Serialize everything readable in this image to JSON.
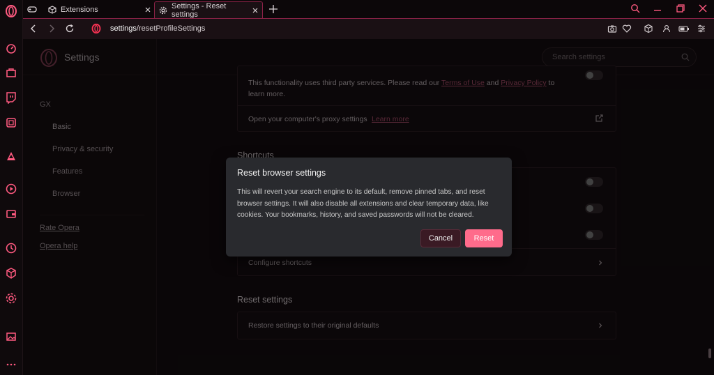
{
  "tabs": [
    {
      "label": "Extensions"
    },
    {
      "label": "Settings - Reset settings"
    }
  ],
  "address": {
    "host": "settings",
    "path": "/resetProfileSettings"
  },
  "settings": {
    "header_title": "Settings",
    "search_placeholder": "Search settings",
    "nav": {
      "section": "GX",
      "items": [
        "Basic",
        "Privacy & security",
        "Features",
        "Browser"
      ],
      "links": [
        "Rate Opera",
        "Opera help"
      ]
    },
    "proxy_card": {
      "notice_pre": "This functionality uses third party services. Please read our",
      "terms": "Terms of Use",
      "and": "and",
      "privacy": "Privacy Policy",
      "notice_post": "to",
      "notice_line2": "learn more.",
      "proxy_label": "Open your computer's proxy settings",
      "learn_more": "Learn more"
    },
    "shortcuts": {
      "title": "Shortcuts",
      "configure": "Configure shortcuts"
    },
    "reset": {
      "title": "Reset settings",
      "restore": "Restore settings to their original defaults"
    }
  },
  "dialog": {
    "title": "Reset browser settings",
    "body": "This will revert your search engine to its default, remove pinned tabs, and reset browser settings. It will also disable all extensions and clear temporary data, like cookies. Your bookmarks, history, and saved passwords will not be cleared.",
    "cancel": "Cancel",
    "reset": "Reset"
  },
  "colors": {
    "accent": "#ff6b8b",
    "accent_dark": "#8a2246",
    "dialog_bg": "#292a2e"
  },
  "icons": [
    "opera-logo-icon",
    "speed-dial-icon",
    "shopping-icon",
    "twitch-icon",
    "gx-control-icon",
    "aria-icon",
    "player-icon",
    "wallet-icon",
    "history-icon",
    "extensions-icon",
    "settings-icon",
    "gallery-icon",
    "more-icon",
    "gamepad-icon",
    "cube-icon",
    "gear-icon",
    "close-icon",
    "plus-icon",
    "search-icon",
    "minimize-icon",
    "restore-icon",
    "window-close-icon",
    "back-icon",
    "forward-icon",
    "reload-icon",
    "camera-icon",
    "heart-icon",
    "account-icon",
    "battery-icon",
    "easy-setup-icon",
    "external-link-icon",
    "chevron-right-icon"
  ]
}
